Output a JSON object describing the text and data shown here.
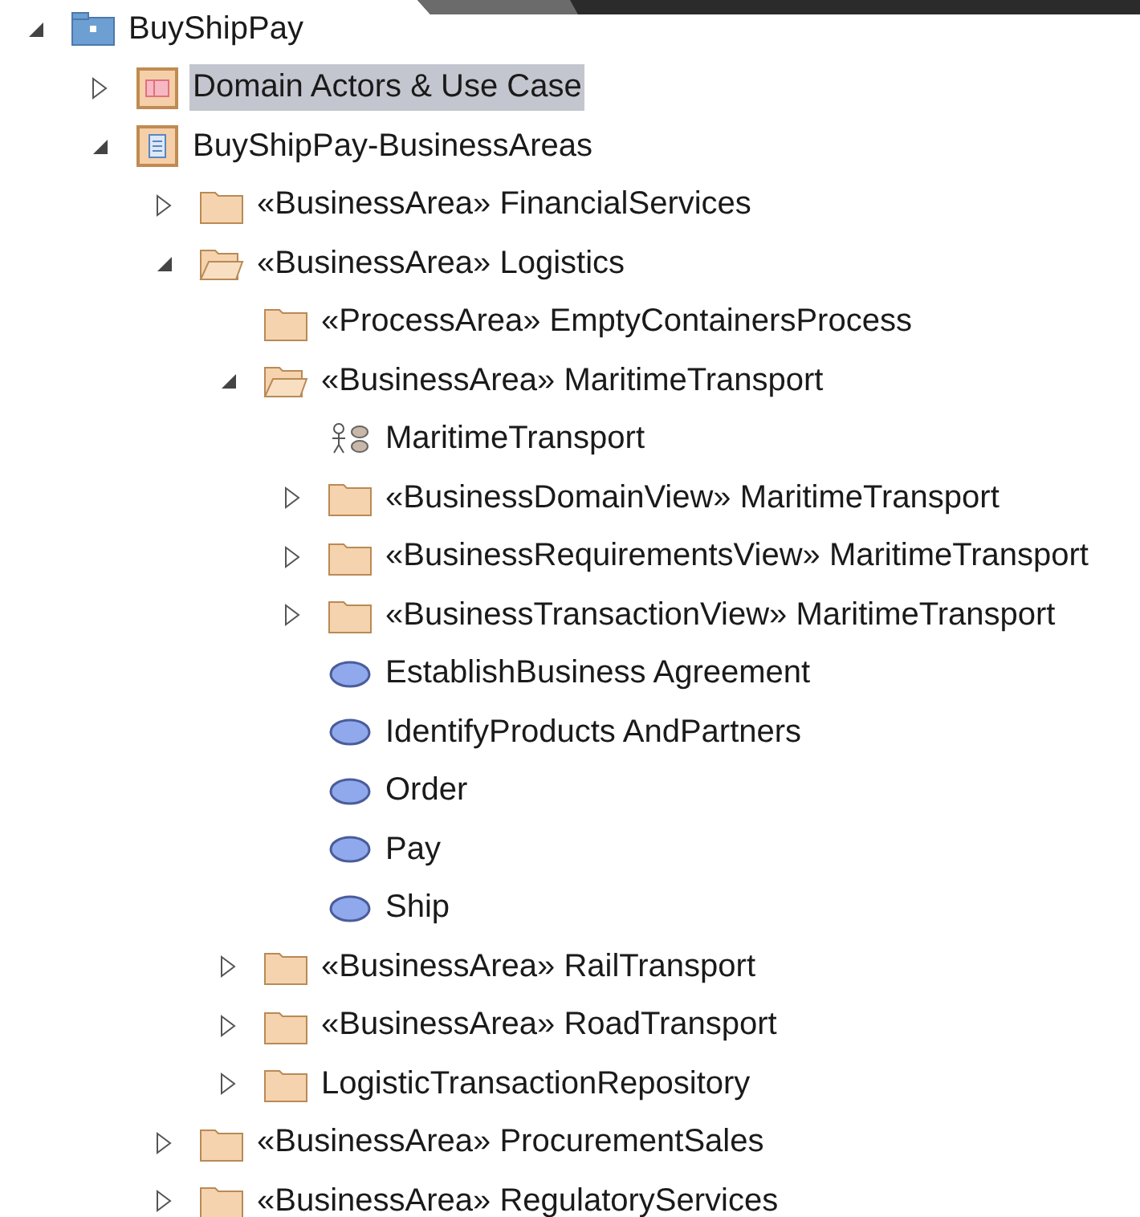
{
  "tree": [
    {
      "label": "BuyShipPay",
      "kind": "model",
      "expanded": true,
      "selected": false,
      "children": [
        {
          "label": "Domain Actors & Use Case",
          "kind": "diagram-package",
          "expanded": false,
          "selected": true
        },
        {
          "label": "BuyShipPay-BusinessAreas",
          "kind": "list-package",
          "expanded": true,
          "selected": false,
          "children": [
            {
              "label": "«BusinessArea» FinancialServices",
              "kind": "folder",
              "expanded": false,
              "selected": false
            },
            {
              "label": "«BusinessArea» Logistics",
              "kind": "folder",
              "expanded": true,
              "selected": false,
              "children": [
                {
                  "label": "«ProcessArea» EmptyContainersProcess",
                  "kind": "folder",
                  "selected": false
                },
                {
                  "label": "«BusinessArea» MaritimeTransport",
                  "kind": "folder",
                  "expanded": true,
                  "selected": false,
                  "children": [
                    {
                      "label": "MaritimeTransport",
                      "kind": "use-case-diagram",
                      "selected": false
                    },
                    {
                      "label": "«BusinessDomainView» MaritimeTransport",
                      "kind": "folder",
                      "expanded": false,
                      "selected": false
                    },
                    {
                      "label": "«BusinessRequirementsView» MaritimeTransport",
                      "kind": "folder",
                      "expanded": false,
                      "selected": false
                    },
                    {
                      "label": "«BusinessTransactionView» MaritimeTransport",
                      "kind": "folder",
                      "expanded": false,
                      "selected": false
                    },
                    {
                      "label": "EstablishBusiness Agreement",
                      "kind": "use-case",
                      "selected": false
                    },
                    {
                      "label": "IdentifyProducts AndPartners",
                      "kind": "use-case",
                      "selected": false
                    },
                    {
                      "label": "Order",
                      "kind": "use-case",
                      "selected": false
                    },
                    {
                      "label": "Pay",
                      "kind": "use-case",
                      "selected": false
                    },
                    {
                      "label": "Ship",
                      "kind": "use-case",
                      "selected": false
                    }
                  ]
                },
                {
                  "label": "«BusinessArea» RailTransport",
                  "kind": "folder",
                  "expanded": false,
                  "selected": false
                },
                {
                  "label": "«BusinessArea» RoadTransport",
                  "kind": "folder",
                  "expanded": false,
                  "selected": false
                },
                {
                  "label": "LogisticTransactionRepository",
                  "kind": "folder",
                  "expanded": false,
                  "selected": false
                }
              ]
            },
            {
              "label": "«BusinessArea» ProcurementSales",
              "kind": "folder",
              "expanded": false,
              "selected": false
            },
            {
              "label": "«BusinessArea» RegulatoryServices",
              "kind": "folder",
              "expanded": false,
              "selected": false
            }
          ]
        }
      ]
    }
  ]
}
